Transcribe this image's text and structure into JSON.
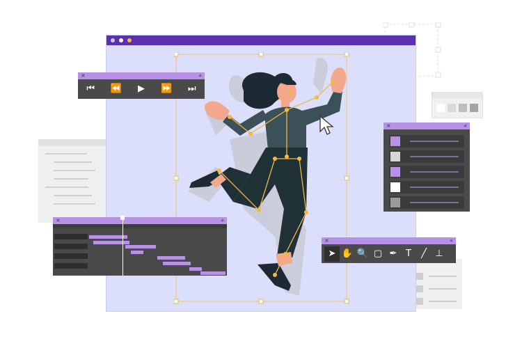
{
  "window": {
    "title_dots": [
      "#c7c7c7",
      "#ffffff",
      "#f4b73f"
    ],
    "titlebar_color": "#5a2fb0",
    "canvas_color": "#dcdffb"
  },
  "panels": {
    "close_glyph": "×",
    "collapse_glyph": "«",
    "header_color": "#b691e6",
    "body_color": "#4a4a4a"
  },
  "media_controls": {
    "buttons": [
      {
        "name": "skip-back",
        "glyph": "⏮"
      },
      {
        "name": "step-back",
        "glyph": "⏪"
      },
      {
        "name": "play",
        "glyph": "▶"
      },
      {
        "name": "step-forward",
        "glyph": "⏩"
      },
      {
        "name": "skip-forward",
        "glyph": "⏭"
      }
    ]
  },
  "layers_panel": {
    "swatches": [
      "#b691e6",
      "#d6d6d6",
      "#b691e6",
      "#ffffff",
      "#9a9a9a"
    ]
  },
  "tools": [
    {
      "name": "pointer-icon",
      "glyph": "➤"
    },
    {
      "name": "hand-icon",
      "glyph": "✋"
    },
    {
      "name": "zoom-icon",
      "glyph": "🔍"
    },
    {
      "name": "rectangle-icon",
      "glyph": "▢"
    },
    {
      "name": "pen-icon",
      "glyph": "✒"
    },
    {
      "name": "text-icon",
      "glyph": "T"
    },
    {
      "name": "brush-icon",
      "glyph": "╱"
    },
    {
      "name": "stamp-icon",
      "glyph": "⊥"
    }
  ],
  "color_swatches_panel": [
    "#ffffff",
    "#d9d9d9",
    "#bdbdbd",
    "#a3a3a3"
  ],
  "accent_color": "#f4b73f",
  "character": {
    "hair": "#1b2a33",
    "skin": "#f3a78d",
    "shirt": "#3c5157",
    "pants": "#1f3037",
    "rig_bone_color": "#f4b73f"
  }
}
